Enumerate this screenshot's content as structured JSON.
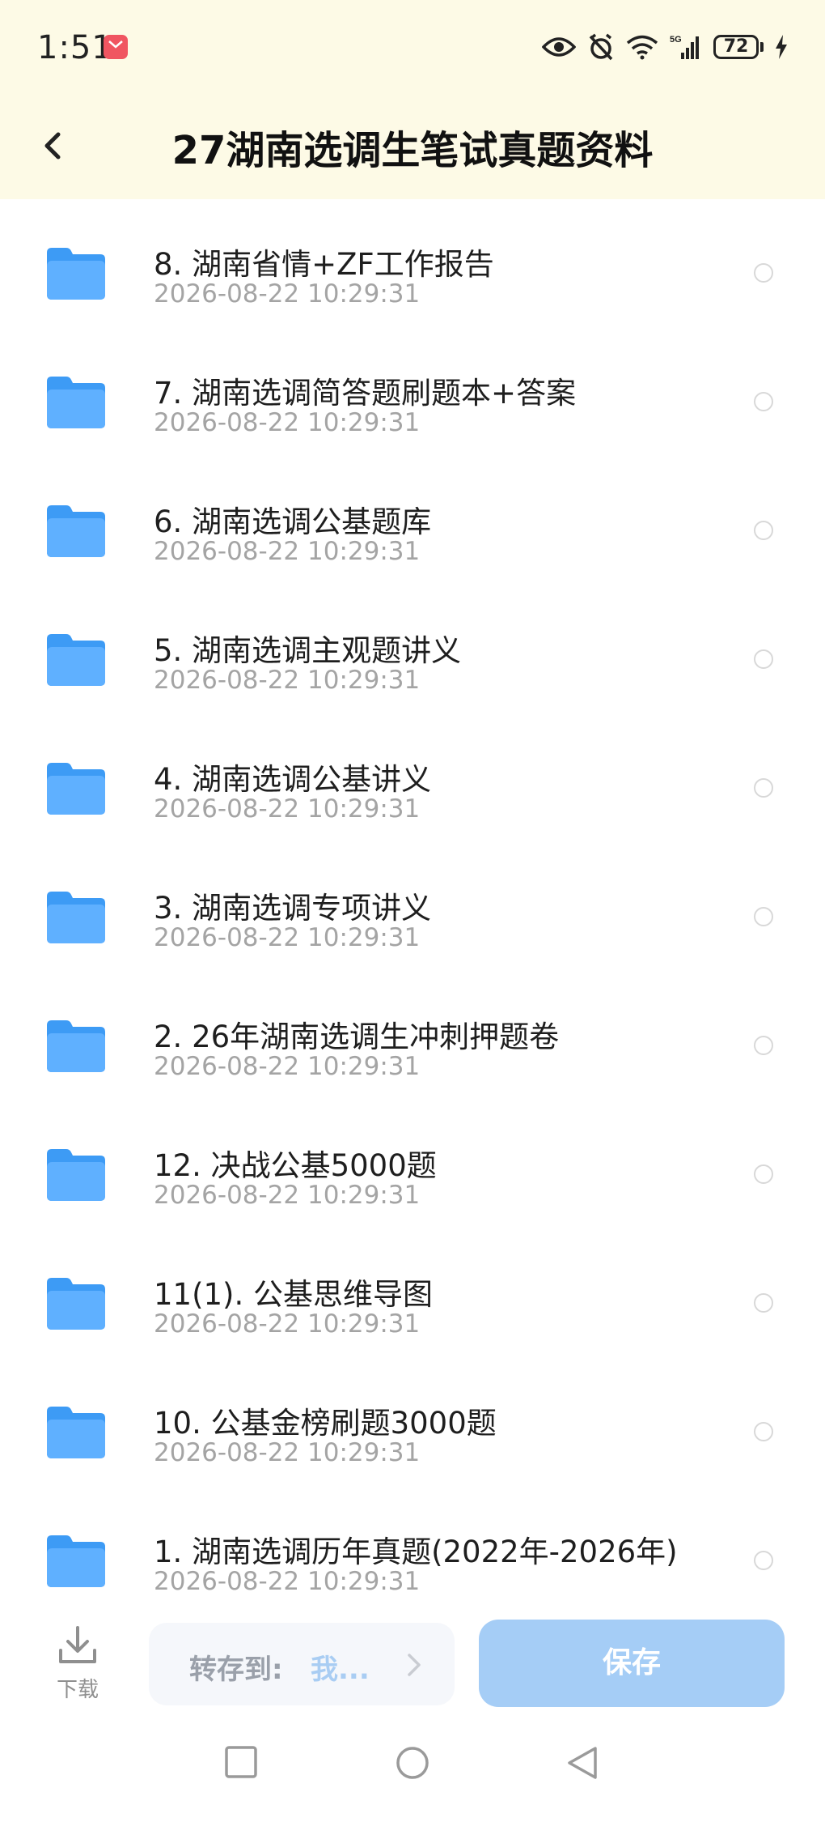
{
  "status_bar": {
    "time": "1:51",
    "battery": "72"
  },
  "header": {
    "title": "27湖南选调生笔试真题资料"
  },
  "files": [
    {
      "name": "8. 湖南省情+ZF工作报告",
      "date": "2026-08-22  10:29:31"
    },
    {
      "name": "7. 湖南选调简答题刷题本+答案",
      "date": "2026-08-22  10:29:31"
    },
    {
      "name": "6. 湖南选调公基题库",
      "date": "2026-08-22  10:29:31"
    },
    {
      "name": "5. 湖南选调主观题讲义",
      "date": "2026-08-22  10:29:31"
    },
    {
      "name": "4. 湖南选调公基讲义",
      "date": "2026-08-22  10:29:31"
    },
    {
      "name": "3. 湖南选调专项讲义",
      "date": "2026-08-22  10:29:31"
    },
    {
      "name": "2. 26年湖南选调生冲刺押题卷",
      "date": "2026-08-22  10:29:31"
    },
    {
      "name": "12. 决战公基5000题",
      "date": "2026-08-22  10:29:31"
    },
    {
      "name": "11(1). 公基思维导图",
      "date": "2026-08-22  10:29:31"
    },
    {
      "name": "10. 公基金榜刷题3000题",
      "date": "2026-08-22  10:29:31"
    },
    {
      "name": "1. 湖南选调历年真题(2022年-2026年)",
      "date": "2026-08-22  10:29:31"
    }
  ],
  "bottom_bar": {
    "download_label": "下载",
    "save_to_label": "转存到:",
    "save_to_value": "我...",
    "save_button": "保存"
  },
  "colors": {
    "header_bg": "#fdfae6",
    "folder_blue": "#3d9bf5",
    "save_button": "#a5cdf6"
  }
}
